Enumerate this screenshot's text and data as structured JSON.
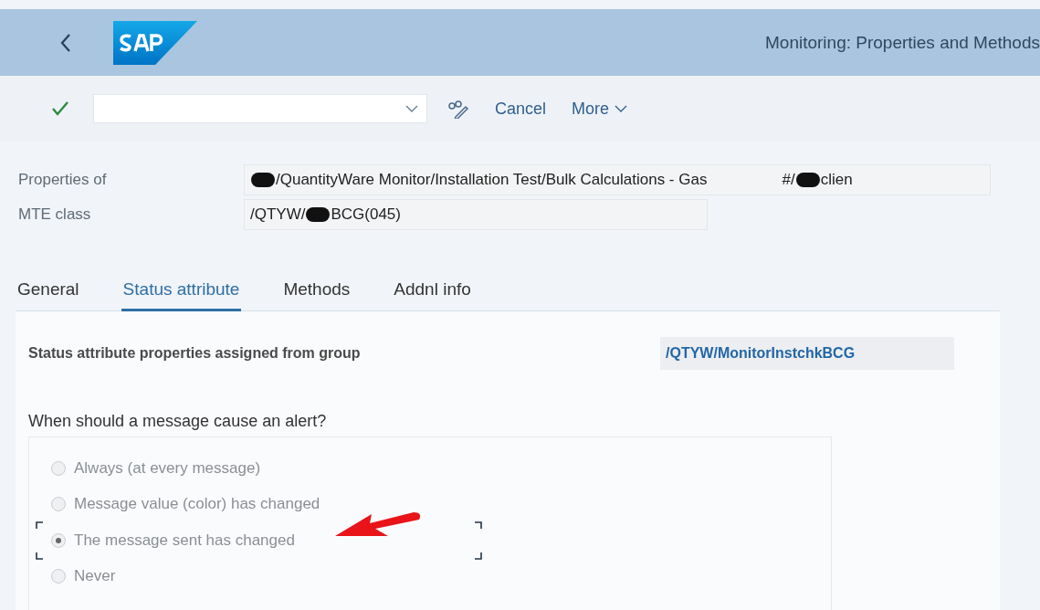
{
  "window": {
    "title": "Monitoring: Properties and Methods"
  },
  "toolbar": {
    "buttons": [
      {
        "label": "Cancel",
        "kind": "plain"
      },
      {
        "label": "More",
        "kind": "menu"
      }
    ]
  },
  "properties": [
    {
      "label": "Properties of",
      "segments": [
        {
          "kind": "redacted"
        },
        {
          "kind": "text",
          "text": "/QuantityWare Monitor/Installation Test/Bulk Calculations - Gas"
        },
        {
          "kind": "gap"
        },
        {
          "kind": "text",
          "text": "#/"
        },
        {
          "kind": "redacted"
        },
        {
          "kind": "text",
          "text": "clien"
        }
      ],
      "wide": true
    },
    {
      "label": "MTE class",
      "segments": [
        {
          "kind": "text",
          "text": "/QTYW/"
        },
        {
          "kind": "redacted"
        },
        {
          "kind": "text",
          "text": "BCG(045)"
        }
      ],
      "wide": false
    }
  ],
  "tabs": [
    {
      "label": "General",
      "selected": false
    },
    {
      "label": "Status attribute",
      "selected": true
    },
    {
      "label": "Methods",
      "selected": false
    },
    {
      "label": "Addnl info",
      "selected": false
    }
  ],
  "panel": {
    "group_label": "Status attribute properties assigned from group",
    "group_value": "/QTYW/MonitorInstchkBCG",
    "question": "When should a message cause an alert?",
    "options": [
      {
        "label": "Always (at every message)",
        "selected": false,
        "focused": false,
        "disabled": true
      },
      {
        "label": "Message value (color) has changed",
        "selected": false,
        "focused": false,
        "disabled": true
      },
      {
        "label": "The message sent has changed",
        "selected": true,
        "focused": true,
        "disabled": true
      },
      {
        "label": "Never",
        "selected": false,
        "focused": false,
        "disabled": true
      }
    ]
  }
}
